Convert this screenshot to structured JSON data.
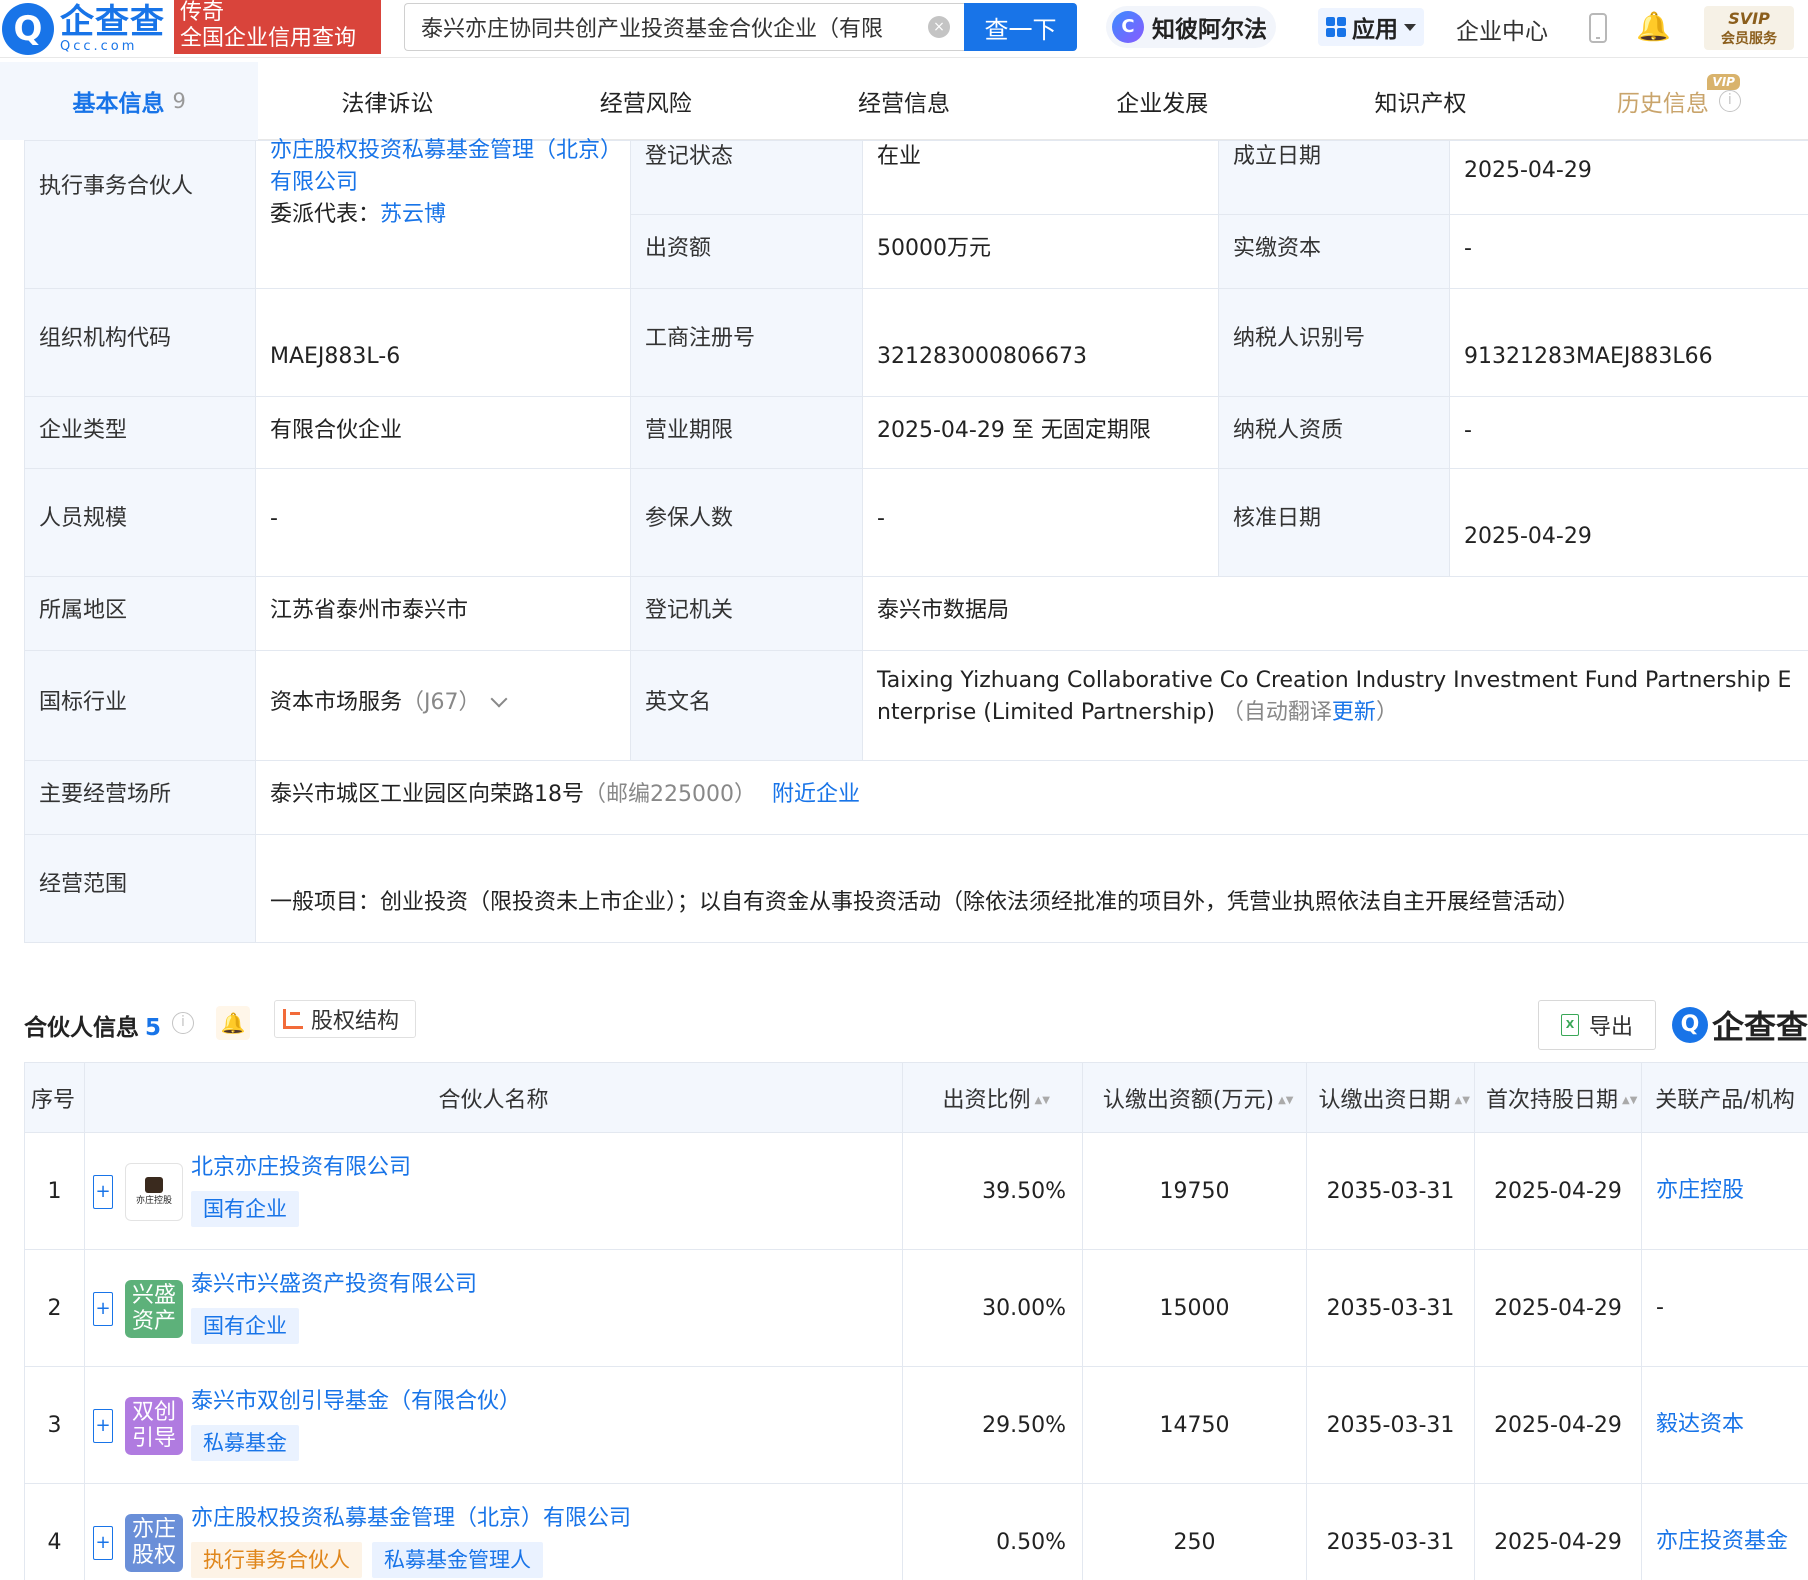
{
  "header": {
    "logo_cn": "企查查",
    "logo_en": "Qcc.com",
    "banner_line1": "传奇",
    "banner_line2": "全国企业信用查询",
    "search_value": "泰兴亦庄协同共创产业投资基金合伙企业（有限",
    "search_button": "查一下",
    "ai_label": "知彼阿尔法",
    "apps_label": "应用",
    "center_link": "企业中心",
    "svip_title": "SVIP",
    "svip_sub": "会员服务"
  },
  "tabs": [
    {
      "label": "基本信息",
      "count": "9"
    },
    {
      "label": "法律诉讼"
    },
    {
      "label": "经营风险"
    },
    {
      "label": "经营信息"
    },
    {
      "label": "企业发展"
    },
    {
      "label": "知识产权"
    },
    {
      "label": "历史信息",
      "badge": "VIP"
    }
  ],
  "basic": {
    "exec_partner_label": "执行事务合伙人",
    "exec_partner_name": "亦庄股权投资私募基金管理（北京）有限公司",
    "delegate_label": "委派代表：",
    "delegate_name": "苏云博",
    "reg_status_label": "登记状态",
    "reg_status": "在业",
    "est_date_label": "成立日期",
    "est_date": "2025-04-29",
    "capital_label": "出资额",
    "capital": "50000万元",
    "paid_label": "实缴资本",
    "paid": "-",
    "org_code_label": "组织机构代码",
    "org_code": "MAEJ883L-6",
    "biz_reg_label": "工商注册号",
    "biz_reg": "321283000806673",
    "tax_id_label": "纳税人识别号",
    "tax_id": "91321283MAEJ883L66",
    "type_label": "企业类型",
    "type": "有限合伙企业",
    "term_label": "营业期限",
    "term": "2025-04-29 至 无固定期限",
    "tax_qual_label": "纳税人资质",
    "tax_qual": "-",
    "staff_label": "人员规模",
    "staff": "-",
    "insured_label": "参保人数",
    "insured": "-",
    "approve_label": "核准日期",
    "approve": "2025-04-29",
    "region_label": "所属地区",
    "region": "江苏省泰州市泰兴市",
    "authority_label": "登记机关",
    "authority": "泰兴市数据局",
    "industry_label": "国标行业",
    "industry": "资本市场服务",
    "industry_code": "（J67）",
    "en_label": "英文名",
    "en_name": "Taixing Yizhuang Collaborative Co Creation Industry Investment Fund Partnership Enterprise (Limited Partnership)",
    "en_note_prefix": "（自动翻译",
    "en_note_link": "更新",
    "en_note_suffix": "）",
    "address_label": "主要经营场所",
    "address": "泰兴市城区工业园区向荣路18号",
    "postcode": "（邮编225000）",
    "nearby_link": "附近企业",
    "scope_label": "经营范围",
    "scope": "一般项目：创业投资（限投资未上市企业）；以自有资金从事投资活动（除依法须经批准的项目外，凭营业执照依法自主开展经营活动）"
  },
  "partners": {
    "title": "合伙人信息",
    "count": "5",
    "equity_label": "股权结构",
    "export_label": "导出",
    "brand": "企查查",
    "columns": [
      "序号",
      "合伙人名称",
      "出资比例",
      "认缴出资额(万元)",
      "认缴出资日期",
      "首次持股日期",
      "关联产品/机构"
    ],
    "rows": [
      {
        "idx": "1",
        "logo_text": "亦庄控股",
        "logo_color": "#ffffff",
        "name": "北京亦庄投资有限公司",
        "tags": [
          "国有企业"
        ],
        "ratio": "39.50%",
        "amount": "19750",
        "sub_date": "2035-03-31",
        "first_date": "2025-04-29",
        "related": "亦庄控股"
      },
      {
        "idx": "2",
        "logo_text": "兴盛资产",
        "logo_color": "#5db17a",
        "name": "泰兴市兴盛资产投资有限公司",
        "tags": [
          "国有企业"
        ],
        "ratio": "30.00%",
        "amount": "15000",
        "sub_date": "2035-03-31",
        "first_date": "2025-04-29",
        "related": "-"
      },
      {
        "idx": "3",
        "logo_text": "双创引导",
        "logo_color": "#b07be0",
        "name": "泰兴市双创引导基金（有限合伙）",
        "tags": [
          "私募基金"
        ],
        "ratio": "29.50%",
        "amount": "14750",
        "sub_date": "2035-03-31",
        "first_date": "2025-04-29",
        "related": "毅达资本"
      },
      {
        "idx": "4",
        "logo_text": "亦庄股权",
        "logo_color": "#6a8fd8",
        "name": "亦庄股权投资私募基金管理（北京）有限公司",
        "tags": [
          "执行事务合伙人",
          "私募基金管理人"
        ],
        "ratio": "0.50%",
        "amount": "250",
        "sub_date": "2035-03-31",
        "first_date": "2025-04-29",
        "related": "亦庄投资基金"
      }
    ]
  }
}
